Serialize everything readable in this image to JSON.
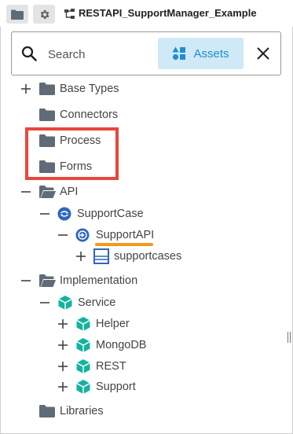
{
  "toolbar": {
    "project_title": "RESTAPI_SupportManager_Example",
    "buttons": [
      "folder-icon",
      "gear-icon"
    ]
  },
  "search": {
    "placeholder": "Search",
    "value": "",
    "assets_label": "Assets"
  },
  "tree": {
    "base_types": "Base Types",
    "connectors": "Connectors",
    "process": "Process",
    "forms": "Forms",
    "api": "API",
    "support_case": "SupportCase",
    "support_api": "SupportAPI",
    "supportcases": "supportcases",
    "implementation": "Implementation",
    "service": "Service",
    "helper": "Helper",
    "mongodb": "MongoDB",
    "rest": "REST",
    "support": "Support",
    "libraries": "Libraries"
  },
  "colors": {
    "folder": "#5f6b76",
    "api_blue": "#3066be",
    "service_teal": "#13b3a0",
    "highlight_red": "#e8463b",
    "underline_orange": "#f39a1b",
    "assets_bg": "#cfe9f6",
    "assets_text": "#1e8fcf"
  }
}
